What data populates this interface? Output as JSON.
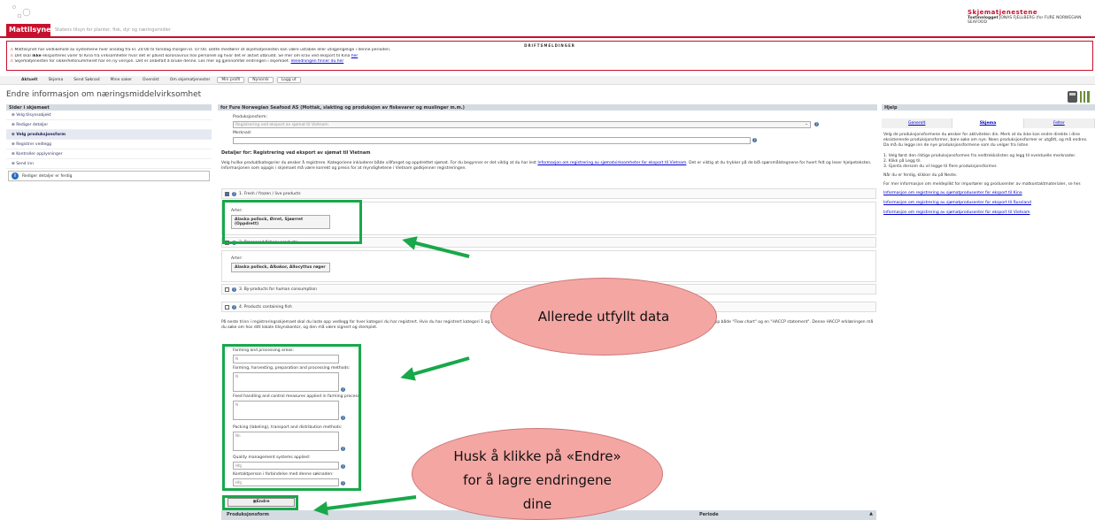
{
  "header": {
    "service_name": "Skjematjenestene",
    "login_label": "Tostinnlogget",
    "login_user": "JONAS FJELLBERG (for FURE NORWEGIAN SEAFOOD",
    "logo_text": "Mattilsynet",
    "slogan": "Statens tilsyn for planter, fisk, dyr og næringsmidler"
  },
  "alerts": {
    "title": "DRIFTSMELDINGER",
    "line1": "Mattilsynet har vedlikehold av systemene hver onsdag fra kl. 20:00 til torsdag morgen kl. 07:00. Dette medfører at skjematjenesten kan være ustabile eller utilgjengelige i denne perioden.",
    "line2_pre": "Det skal ",
    "line2_bold": "ikke",
    "line2_post": " eksporteres varer til Kina fra virksomheter hvor det er påvist koronavirus hos personell og hvor det er aktivt utbrudd. Se mer om krav ved eksport til Kina ",
    "line2_link": "her",
    "line3": "Skjematjenesten for sikkerhetsnummeret har en ny versjon. Det er anbefalt å bruke denne. Les mer og gjennomfør endringen i skjemaet.",
    "line3_link": "Veiledningen finner du her"
  },
  "nav": {
    "items": [
      "Aktuelt",
      "Skjema",
      "Send Søknad",
      "Mine saker",
      "Oversikt",
      "Om skjematjenester",
      "Min profil",
      "Nynorsk",
      "Logg ut"
    ]
  },
  "page_title": "Endre informasjon om næringsmiddelvirksomhet",
  "sidebar": {
    "header": "Sider i skjemaet",
    "items": [
      "Velg tilsynsobjekt",
      "Rediger detaljer",
      "Velg produksjonsform",
      "Registrer vedlegg",
      "Kontroller opplysninger",
      "Send inn"
    ],
    "info_text": "Rediger detaljer er ferdig"
  },
  "main": {
    "header": "for Fure Norwegian Seafood AS (Mottak, slakting og produksjon av fiskevarer og muslinger m.m.)",
    "production_label": "Produksjonsform:",
    "production_value": "Registrering ved eksport av sjømat til Vietnam",
    "remarks_label": "Merknad:",
    "details_title": "Detaljer for: Registrering ved eksport av sjømat til Vietnam",
    "intro_pre": "Velg hvilke produktkategorier du ønsker å registrere. Kategoriene inkluderer både villfanget og oppdrettet sjømat. For du begynner er det viktig at du har lest ",
    "intro_link": "Informasjon om registrering av sjømatvirksomheter for eksport til Vietnam",
    "intro_post": ". Det er viktig at du trykker på de blå spørsmålstegnene for hvert felt og leser hjelpeteksten. Informasjonen som oppgis i skjemaet må være korrekt og presis for at myndighetene i Vietnam godkjenner registreringen.",
    "cat1": "1. Fresh / frozen / live products",
    "arter_label": "Arter:",
    "arter1": "Alaska pollock, Ørret, Sjøørret (Oppdrett)",
    "cat2": "2. Processed fishery products",
    "arter2": "Alaska pollock, Albakor, Allocyttus røger",
    "cat3": "3. By-products for human consumption",
    "cat4": "4. Products containing fish",
    "para2": "På neste trinn i registreringsskjemaet skal du laste opp vedlegg for hver kategori du har registrert. Hvis du har registrert kategori 1 og 2 må vedlegget vise produksjonsflyten for hver produktkategori. Hvis du har registrert kategori 3 skal du laste opp både \"Flow chart\" og en \"HACCP statement\". Denne HACCP erklæringen må du søke om hos ditt lokale tilsynskontor, og den må være signert og stemplet.",
    "fields": [
      {
        "label": "Farming and processing areas:",
        "value": "N"
      },
      {
        "label": "Farming, harvesting, preparation and processing methods:",
        "value": "N"
      },
      {
        "label": "Feed handling and control measures applied in farming process:",
        "value": "N"
      },
      {
        "label": "Packing (labeling), transport and distribution methods:",
        "value": "Nn"
      },
      {
        "label": "Quality management systems applied:",
        "value": "Hfg"
      },
      {
        "label": "Kontaktperson i forbindelse med denne søknaden:",
        "value": "Hfg"
      }
    ],
    "endre_button": "Endre",
    "table_col1": "Produksjonsform",
    "table_col2": "Periode"
  },
  "help": {
    "header": "Hjelp",
    "tabs": [
      "Generelt",
      "Skjema",
      "Felter"
    ],
    "p1": "Velg de produksjonsformene du ønsker for aktiviteten din. Merk at du ikke kan endre direkte i dine eksisterende produksjonsformer, bare søke om nye. Noen produksjonsformer er utgått, og må endres. Da må du legge inn de nye produksjonsformene som du velger fra listen",
    "steps": [
      "1. Velg først den riktige produksjonsformen fra nedtrekkslisten og legg til eventuelle merknader.",
      "2. Klikk på Legg til.",
      "3. Gjenta dersom du vil legge til flere produksjonsformer."
    ],
    "p2": "Når du er ferdig, klikker du på Neste.",
    "p3": "For mer informasjon om meldeplikt for importører og produsenter av matkontaktmaterialer, se her.",
    "links": [
      "Informasjon om registrering av sjømatprodusenter for eksport til Kina",
      "Informasjon om registrering av sjømatprodusenter for eksport til Russland",
      "Informasjon om registrering av sjømatprodusenter for eksport til Vietnam"
    ]
  },
  "callouts": {
    "filled": "Allerede utfyllt data",
    "remember_l1": "Husk å klikke på «Endre»",
    "remember_l2": "for å lagre endringene",
    "remember_l3": "dine"
  },
  "colors": {
    "brand_red": "#c8102e",
    "highlight_green": "#18a84a",
    "bubble_pink": "#f4a6a3"
  }
}
